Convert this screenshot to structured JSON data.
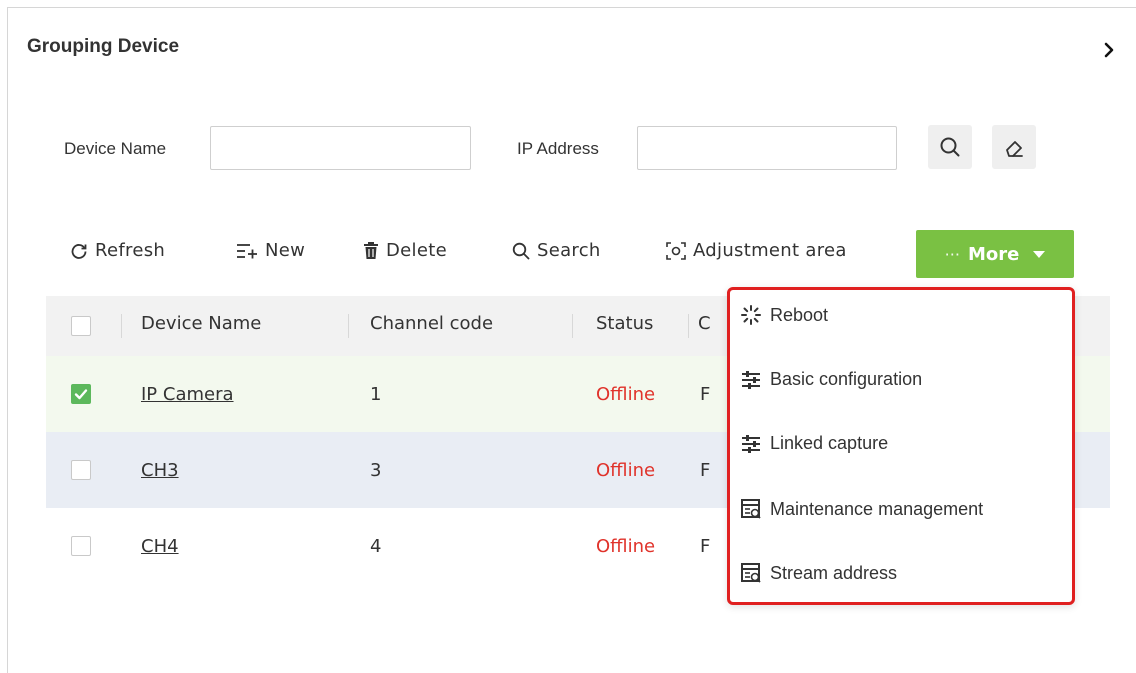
{
  "panel": {
    "title": "Grouping Device",
    "collapse_icon": "chevron-right-icon"
  },
  "filters": {
    "device_name_label": "Device Name",
    "device_name_value": "",
    "ip_address_label": "IP Address",
    "ip_address_value": "",
    "search_icon": "search-icon",
    "clear_icon": "eraser-icon"
  },
  "toolbar": {
    "refresh": "Refresh",
    "new": "New",
    "delete": "Delete",
    "search": "Search",
    "adjustment_area": "Adjustment area",
    "more": "More",
    "more_dots": "···",
    "more_color": "#7ac143"
  },
  "table": {
    "columns": [
      "Device Name",
      "Channel code",
      "Status",
      "C"
    ],
    "rows": [
      {
        "checked": true,
        "device_name": "IP Camera",
        "channel_code": "1",
        "status": "Offline",
        "extra": "F"
      },
      {
        "checked": false,
        "device_name": "CH3",
        "channel_code": "3",
        "status": "Offline",
        "extra": "F"
      },
      {
        "checked": false,
        "device_name": "CH4",
        "channel_code": "4",
        "status": "Offline",
        "extra": "F"
      }
    ],
    "status_color": "#e0332b"
  },
  "more_menu": {
    "highlight_color": "#e02020",
    "items": [
      {
        "label": "Reboot",
        "icon": "reboot-icon"
      },
      {
        "label": "Basic configuration",
        "icon": "sliders-icon"
      },
      {
        "label": "Linked capture",
        "icon": "sliders-icon"
      },
      {
        "label": "Maintenance management",
        "icon": "maintenance-icon"
      },
      {
        "label": "Stream address",
        "icon": "stream-icon"
      }
    ]
  }
}
